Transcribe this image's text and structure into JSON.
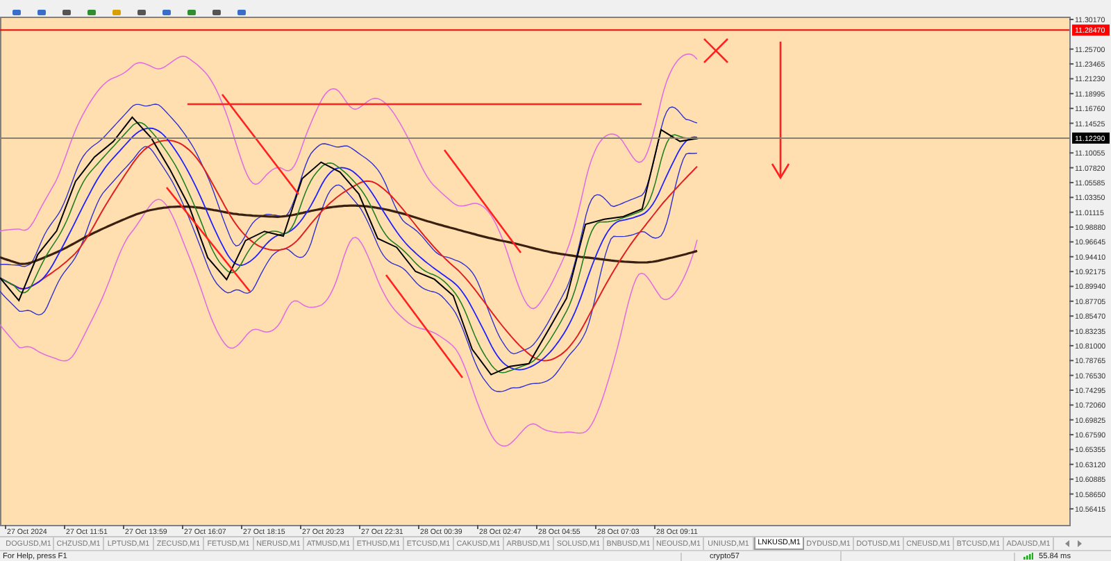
{
  "price_axis": [
    {
      "kind": "tick",
      "label": "11.30170"
    },
    {
      "kind": "marker",
      "label": "11.28470",
      "color": "#ff0000"
    },
    {
      "kind": "tick",
      "label": "11.25700"
    },
    {
      "kind": "tick",
      "label": "11.23465"
    },
    {
      "kind": "tick",
      "label": "11.21230"
    },
    {
      "kind": "tick",
      "label": "11.18995"
    },
    {
      "kind": "tick",
      "label": "11.16760"
    },
    {
      "kind": "tick",
      "label": "11.14525"
    },
    {
      "kind": "marker",
      "label": "11.12290",
      "color": "#000000"
    },
    {
      "kind": "tick",
      "label": "11.10055"
    },
    {
      "kind": "tick",
      "label": "11.07820"
    },
    {
      "kind": "tick",
      "label": "11.05585"
    },
    {
      "kind": "tick",
      "label": "11.03350"
    },
    {
      "kind": "tick",
      "label": "11.01115"
    },
    {
      "kind": "tick",
      "label": "10.98880"
    },
    {
      "kind": "tick",
      "label": "10.96645"
    },
    {
      "kind": "tick",
      "label": "10.94410"
    },
    {
      "kind": "tick",
      "label": "10.92175"
    },
    {
      "kind": "tick",
      "label": "10.89940"
    },
    {
      "kind": "tick",
      "label": "10.87705"
    },
    {
      "kind": "tick",
      "label": "10.85470"
    },
    {
      "kind": "tick",
      "label": "10.83235"
    },
    {
      "kind": "tick",
      "label": "10.81000"
    },
    {
      "kind": "tick",
      "label": "10.78765"
    },
    {
      "kind": "tick",
      "label": "10.76530"
    },
    {
      "kind": "tick",
      "label": "10.74295"
    },
    {
      "kind": "tick",
      "label": "10.72060"
    },
    {
      "kind": "tick",
      "label": "10.69825"
    },
    {
      "kind": "tick",
      "label": "10.67590"
    },
    {
      "kind": "tick",
      "label": "10.65355"
    },
    {
      "kind": "tick",
      "label": "10.63120"
    },
    {
      "kind": "tick",
      "label": "10.60885"
    },
    {
      "kind": "tick",
      "label": "10.58650"
    },
    {
      "kind": "tick",
      "label": "10.56415"
    }
  ],
  "time_axis": [
    "27 Oct 2024",
    "27 Oct 11:51",
    "27 Oct 13:59",
    "27 Oct 16:07",
    "27 Oct 18:15",
    "27 Oct 20:23",
    "27 Oct 22:31",
    "28 Oct 00:39",
    "28 Oct 02:47",
    "28 Oct 04:55",
    "28 Oct 07:03",
    "28 Oct 09:11"
  ],
  "tabs": [
    {
      "label": "DOGUSD,M1",
      "selected": false
    },
    {
      "label": "CHZUSD,M1",
      "selected": false
    },
    {
      "label": "LPTUSD,M1",
      "selected": false
    },
    {
      "label": "ZECUSD,M1",
      "selected": false
    },
    {
      "label": "FETUSD,M1",
      "selected": false
    },
    {
      "label": "NERUSD,M1",
      "selected": false
    },
    {
      "label": "ATMUSD,M1",
      "selected": false
    },
    {
      "label": "ETHUSD,M1",
      "selected": false
    },
    {
      "label": "ETCUSD,M1",
      "selected": false
    },
    {
      "label": "CAKUSD,M1",
      "selected": false
    },
    {
      "label": "ARBUSD,M1",
      "selected": false
    },
    {
      "label": "SOLUSD,M1",
      "selected": false
    },
    {
      "label": "BNBUSD,M1",
      "selected": false
    },
    {
      "label": "NEOUSD,M1",
      "selected": false
    },
    {
      "label": "UNIUSD,M1",
      "selected": false
    },
    {
      "label": "LNKUSD,M1",
      "selected": true
    },
    {
      "label": "DYDUSD,M1",
      "selected": false
    },
    {
      "label": "DOTUSD,M1",
      "selected": false
    },
    {
      "label": "CNEUSD,M1",
      "selected": false
    },
    {
      "label": "BTCUSD,M1",
      "selected": false
    },
    {
      "label": "ADAUSD,M1",
      "selected": false
    }
  ],
  "status_bar": {
    "help": "For Help, press F1",
    "profile": "crypto57",
    "ping": "55.84 ms"
  }
}
